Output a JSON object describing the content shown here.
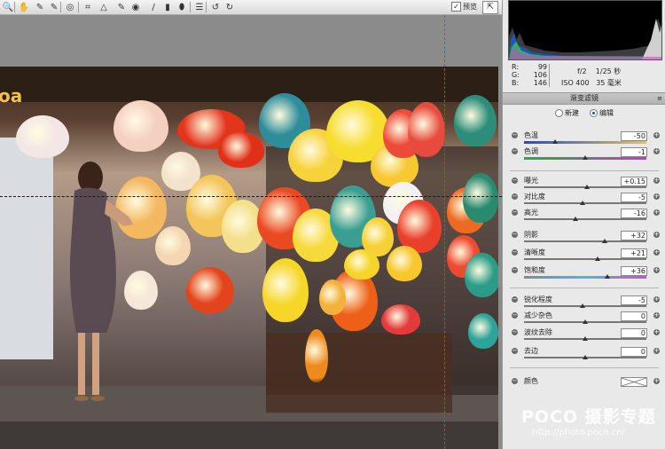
{
  "toolbar": {
    "tools": [
      {
        "name": "zoom-tool",
        "icon": "magnifier-icon",
        "glyph": "🔍"
      },
      {
        "name": "hand-tool",
        "icon": "hand-icon",
        "glyph": "✋"
      },
      {
        "name": "white-balance-tool",
        "icon": "eyedropper-icon",
        "glyph": "✎"
      },
      {
        "name": "color-sampler-tool",
        "icon": "color-sampler-icon",
        "glyph": "✎"
      },
      {
        "name": "targeted-adjustment-tool",
        "icon": "target-adjust-icon",
        "glyph": "◎"
      },
      {
        "name": "crop-tool",
        "icon": "crop-icon",
        "glyph": "⌗"
      },
      {
        "name": "straighten-tool",
        "icon": "straighten-icon",
        "glyph": "△"
      },
      {
        "name": "spot-removal-tool",
        "icon": "spot-removal-icon",
        "glyph": "✎"
      },
      {
        "name": "red-eye-tool",
        "icon": "red-eye-icon",
        "glyph": "◉"
      },
      {
        "name": "adjustment-brush-tool",
        "icon": "brush-icon",
        "glyph": "/"
      },
      {
        "name": "graduated-filter-tool",
        "icon": "graduated-filter-icon",
        "glyph": "▮"
      },
      {
        "name": "radial-filter-tool",
        "icon": "radial-filter-icon",
        "glyph": "⬮"
      },
      {
        "name": "preferences-tool",
        "icon": "list-icon",
        "glyph": "☰"
      },
      {
        "name": "rotate-left-tool",
        "icon": "rotate-left-icon",
        "glyph": "↺"
      },
      {
        "name": "rotate-right-tool",
        "icon": "rotate-right-icon",
        "glyph": "↻"
      }
    ],
    "preview_label": "预览",
    "preview_checked": true
  },
  "readout": {
    "r_label": "R:",
    "r_value": "99",
    "g_label": "G:",
    "g_value": "106",
    "b_label": "B:",
    "b_value": "146",
    "aperture": "f/2",
    "shutter": "1/25 秒",
    "iso": "ISO 400",
    "focal": "35 毫米"
  },
  "panel": {
    "title": "渐变滤镜",
    "menu_icon": "≡",
    "mode_new": "新建",
    "mode_edit": "编辑",
    "mode_selected": "edit",
    "color_label": "颜色"
  },
  "sliders": [
    {
      "label": "色温",
      "value": "-50",
      "level": 0.25,
      "style": "temp"
    },
    {
      "label": "色调",
      "value": "-1",
      "level": 0.497,
      "style": "tint"
    },
    {
      "label": "曝光",
      "value": "+0.15",
      "level": 0.515,
      "style": "plain"
    },
    {
      "label": "对比度",
      "value": "-5",
      "level": 0.475,
      "style": "plain"
    },
    {
      "label": "高光",
      "value": "-16",
      "level": 0.42,
      "style": "plain"
    },
    {
      "label": "阴影",
      "value": "+32",
      "level": 0.66,
      "style": "plain"
    },
    {
      "label": "清晰度",
      "value": "+21",
      "level": 0.605,
      "style": "plain"
    },
    {
      "label": "饱和度",
      "value": "+36",
      "level": 0.68,
      "style": "sat"
    },
    {
      "label": "锐化程度",
      "value": "-5",
      "level": 0.475,
      "style": "plain"
    },
    {
      "label": "减少杂色",
      "value": "0",
      "level": 0.5,
      "style": "plain"
    },
    {
      "label": "波纹去除",
      "value": "0",
      "level": 0.5,
      "style": "plain"
    },
    {
      "label": "去边",
      "value": "0",
      "level": 0.5,
      "style": "plain"
    }
  ],
  "watermark": {
    "title": "POCO 摄影专题",
    "url": "http://photo.poco.cn/"
  }
}
